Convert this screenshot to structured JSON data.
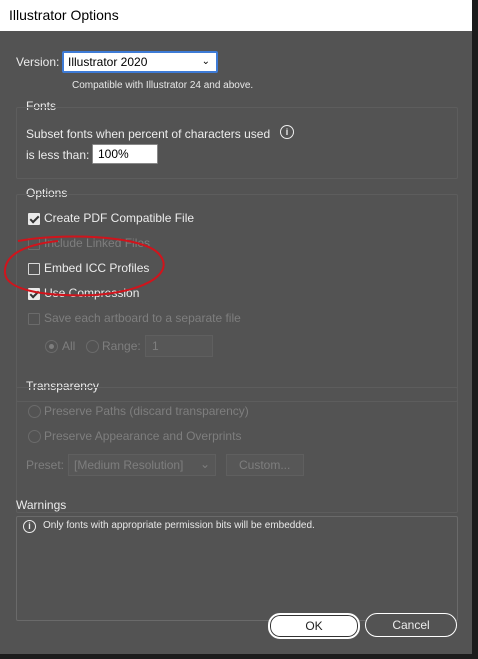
{
  "window": {
    "title": "Illustrator Options"
  },
  "version": {
    "label": "Version:",
    "selected": "Illustrator 2020",
    "note": "Compatible with Illustrator 24 and above."
  },
  "fonts": {
    "heading": "Fonts",
    "subset_label_1": "Subset fonts when percent of characters used",
    "subset_label_2": "is less than:",
    "subset_value": "100%"
  },
  "options": {
    "heading": "Options",
    "create_pdf": {
      "label": "Create PDF Compatible File",
      "checked": true
    },
    "include_linked": {
      "label": "Include Linked Files",
      "checked": false,
      "disabled": true
    },
    "embed_icc": {
      "label": "Embed ICC Profiles",
      "checked": false
    },
    "use_compression": {
      "label": "Use Compression",
      "checked": true
    },
    "save_artboards": {
      "label": "Save each artboard to a separate file",
      "checked": false,
      "disabled": true
    },
    "all_label": "All",
    "range_label": "Range:",
    "range_value": "1"
  },
  "transparency": {
    "heading": "Transparency",
    "preserve_paths": "Preserve Paths (discard transparency)",
    "preserve_appearance": "Preserve Appearance and Overprints",
    "preset_label": "Preset:",
    "preset_value": "[Medium Resolution]",
    "custom_label": "Custom..."
  },
  "warnings": {
    "heading": "Warnings",
    "message": "Only fonts with appropriate permission bits will be embedded."
  },
  "buttons": {
    "ok": "OK",
    "cancel": "Cancel"
  },
  "colors": {
    "dialog_bg": "#535353",
    "focus": "#3e7bd6",
    "annotation": "#d0141c"
  }
}
